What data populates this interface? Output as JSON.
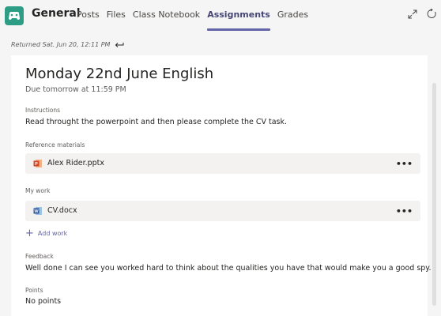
{
  "header": {
    "team_name": "General",
    "tabs": [
      {
        "label": "Posts"
      },
      {
        "label": "Files"
      },
      {
        "label": "Class Notebook"
      },
      {
        "label": "Assignments",
        "active": true
      },
      {
        "label": "Grades"
      }
    ]
  },
  "returned_text": "Returned Sat. Jun 20, 12:11 PM",
  "assignment": {
    "title": "Monday 22nd June English",
    "due": "Due tomorrow at 11:59 PM",
    "instructions_label": "Instructions",
    "instructions_text": "Read throught the powerpoint and then please complete the CV task.",
    "reference_label": "Reference materials",
    "reference_file": "Alex Rider.pptx",
    "my_work_label": "My work",
    "my_work_file": "CV.docx",
    "add_work_label": "Add work",
    "feedback_label": "Feedback",
    "feedback_text": "Well done I can see you worked hard to think about the qualities you have that would make you a good spy.",
    "points_label": "Points",
    "points_text": "No points"
  },
  "more_glyph": "•••",
  "colors": {
    "accent": "#6264a7",
    "team_icon": "#2d9d86",
    "ppt": "#d24726",
    "word": "#2b579a"
  },
  "icons": [
    "team-icon",
    "popout-icon",
    "refresh-icon",
    "return-arrow-icon",
    "powerpoint-file-icon",
    "word-file-icon",
    "more-options-icon",
    "plus-icon"
  ]
}
